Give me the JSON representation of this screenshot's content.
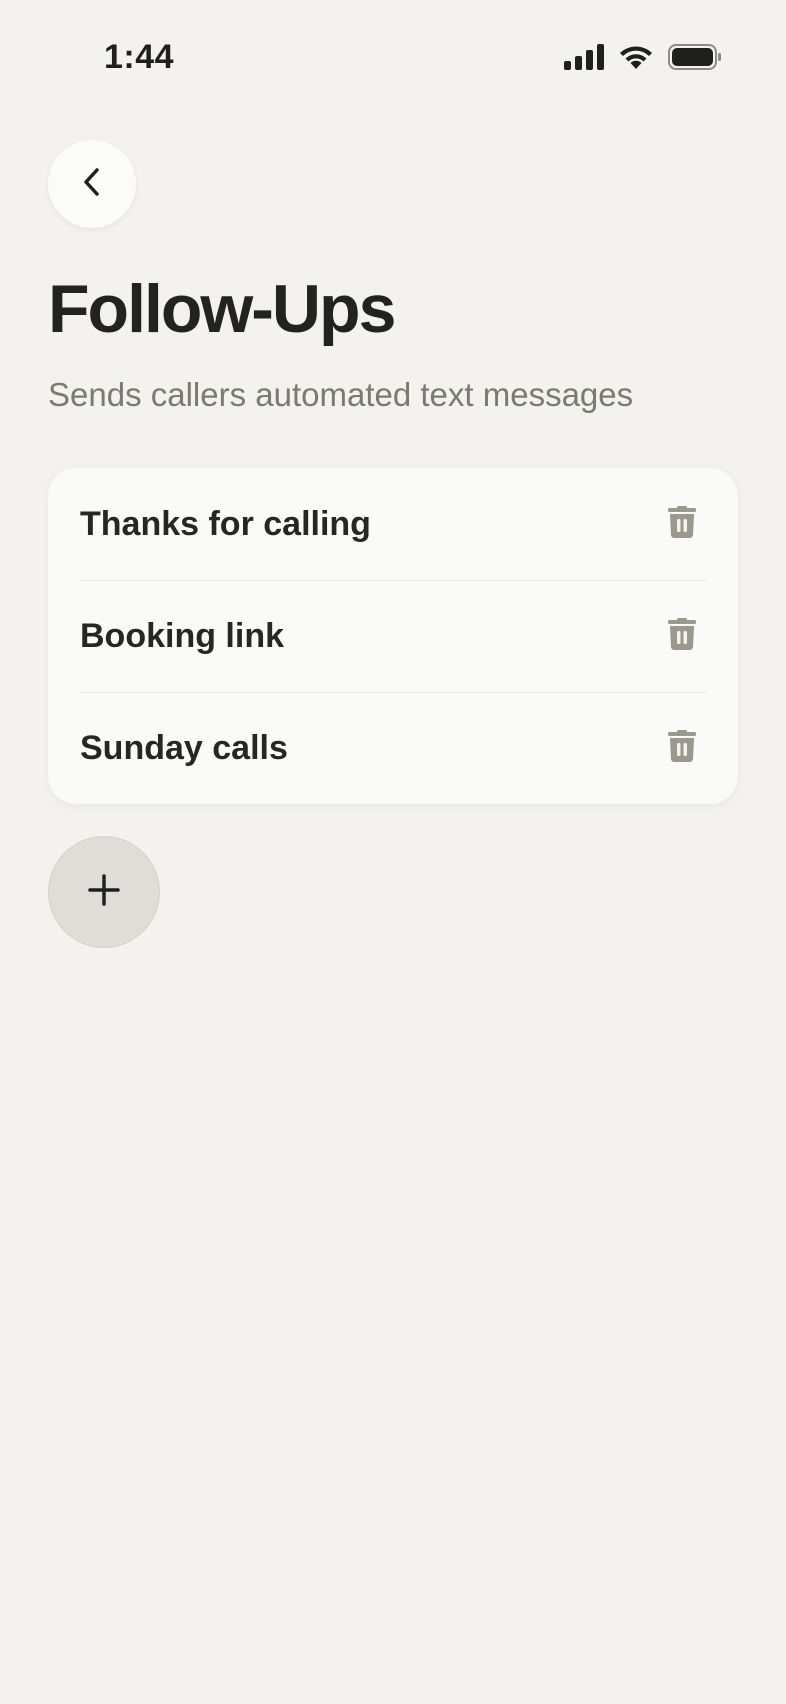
{
  "status_bar": {
    "time": "1:44",
    "icons": [
      "cellular-signal-icon",
      "wifi-icon",
      "battery-icon"
    ]
  },
  "header": {
    "back_icon": "chevron-left-icon",
    "title": "Follow-Ups",
    "subtitle": "Sends callers automated text messages"
  },
  "follow_ups": {
    "items": [
      {
        "label": "Thanks for calling",
        "action_icon": "trash-icon"
      },
      {
        "label": "Booking link",
        "action_icon": "trash-icon"
      },
      {
        "label": "Sunday calls",
        "action_icon": "trash-icon"
      }
    ]
  },
  "add_button": {
    "icon": "plus-icon"
  },
  "colors": {
    "background": "#f3f2ee",
    "card": "#fafaf9",
    "text_primary": "#22221f",
    "text_secondary": "#7a7a74",
    "icon_muted": "#9b988f",
    "add_button_bg": "#deddd8"
  }
}
